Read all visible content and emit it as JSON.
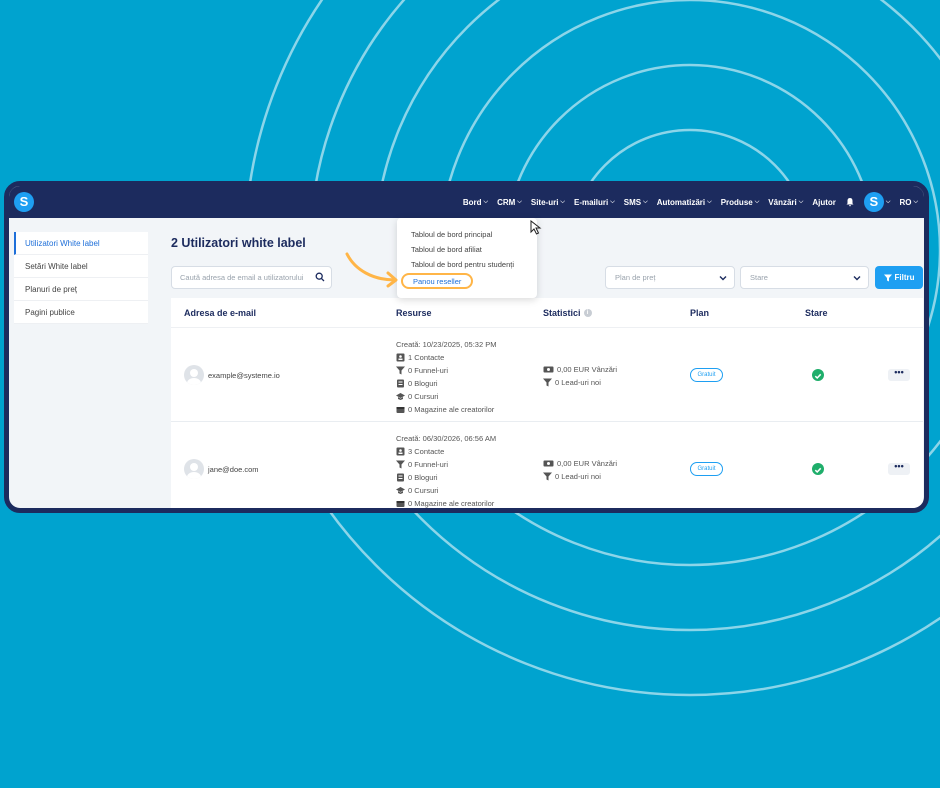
{
  "colors": {
    "background": "#00a3cf",
    "navbar": "#1c2b5e",
    "accent": "#1e9ff2",
    "highlight": "#ffb547",
    "success": "#1fae6b"
  },
  "nav": {
    "logo": "S",
    "items": [
      {
        "label": "Bord",
        "has_chevron": true
      },
      {
        "label": "CRM",
        "has_chevron": true
      },
      {
        "label": "Site-uri",
        "has_chevron": true
      },
      {
        "label": "E-mailuri",
        "has_chevron": true
      },
      {
        "label": "SMS",
        "has_chevron": true
      },
      {
        "label": "Automatizări",
        "has_chevron": true
      },
      {
        "label": "Produse",
        "has_chevron": true
      },
      {
        "label": "Vânzări",
        "has_chevron": true
      },
      {
        "label": "Ajutor",
        "has_chevron": false
      }
    ],
    "avatar_letter": "S",
    "language": "RO"
  },
  "sidebar": {
    "items": [
      {
        "label": "Utilizatori White label",
        "active": true
      },
      {
        "label": "Setări White label",
        "active": false
      },
      {
        "label": "Planuri de preț",
        "active": false
      },
      {
        "label": "Pagini publice",
        "active": false
      }
    ]
  },
  "main": {
    "title": "2 Utilizatori white label",
    "search_placeholder": "Caută adresa de email a utilizatorului",
    "plan_select": "Plan de preț",
    "status_select": "Stare",
    "filter_label": "Filtru"
  },
  "dropdown": {
    "items": [
      "Tabloul de bord principal",
      "Tabloul de bord afiliat",
      "Tabloul de bord pentru studenți",
      "Panou reseller"
    ]
  },
  "table": {
    "headers": [
      "Adresa de e-mail",
      "Resurse",
      "Statistici",
      "Plan",
      "Stare"
    ],
    "rows": [
      {
        "email": "example@systeme.io",
        "created": "Creată: 10/23/2025, 05:32 PM",
        "contacts": "1 Contacte",
        "funnels": "0 Funnel-uri",
        "blogs": "0 Bloguri",
        "courses": "0 Cursuri",
        "stores": "0 Magazine ale creatorilor",
        "sales": "0,00 EUR Vânzări",
        "leads": "0 Lead-uri noi",
        "plan": "Gratuit",
        "more": "•••"
      },
      {
        "email": "jane@doe.com",
        "created": "Creată: 06/30/2026, 06:56 AM",
        "contacts": "3 Contacte",
        "funnels": "0 Funnel-uri",
        "blogs": "0 Bloguri",
        "courses": "0 Cursuri",
        "stores": "0 Magazine ale creatorilor",
        "sales": "0,00 EUR Vânzări",
        "leads": "0 Lead-uri noi",
        "plan": "Gratuit",
        "more": "•••"
      }
    ]
  }
}
